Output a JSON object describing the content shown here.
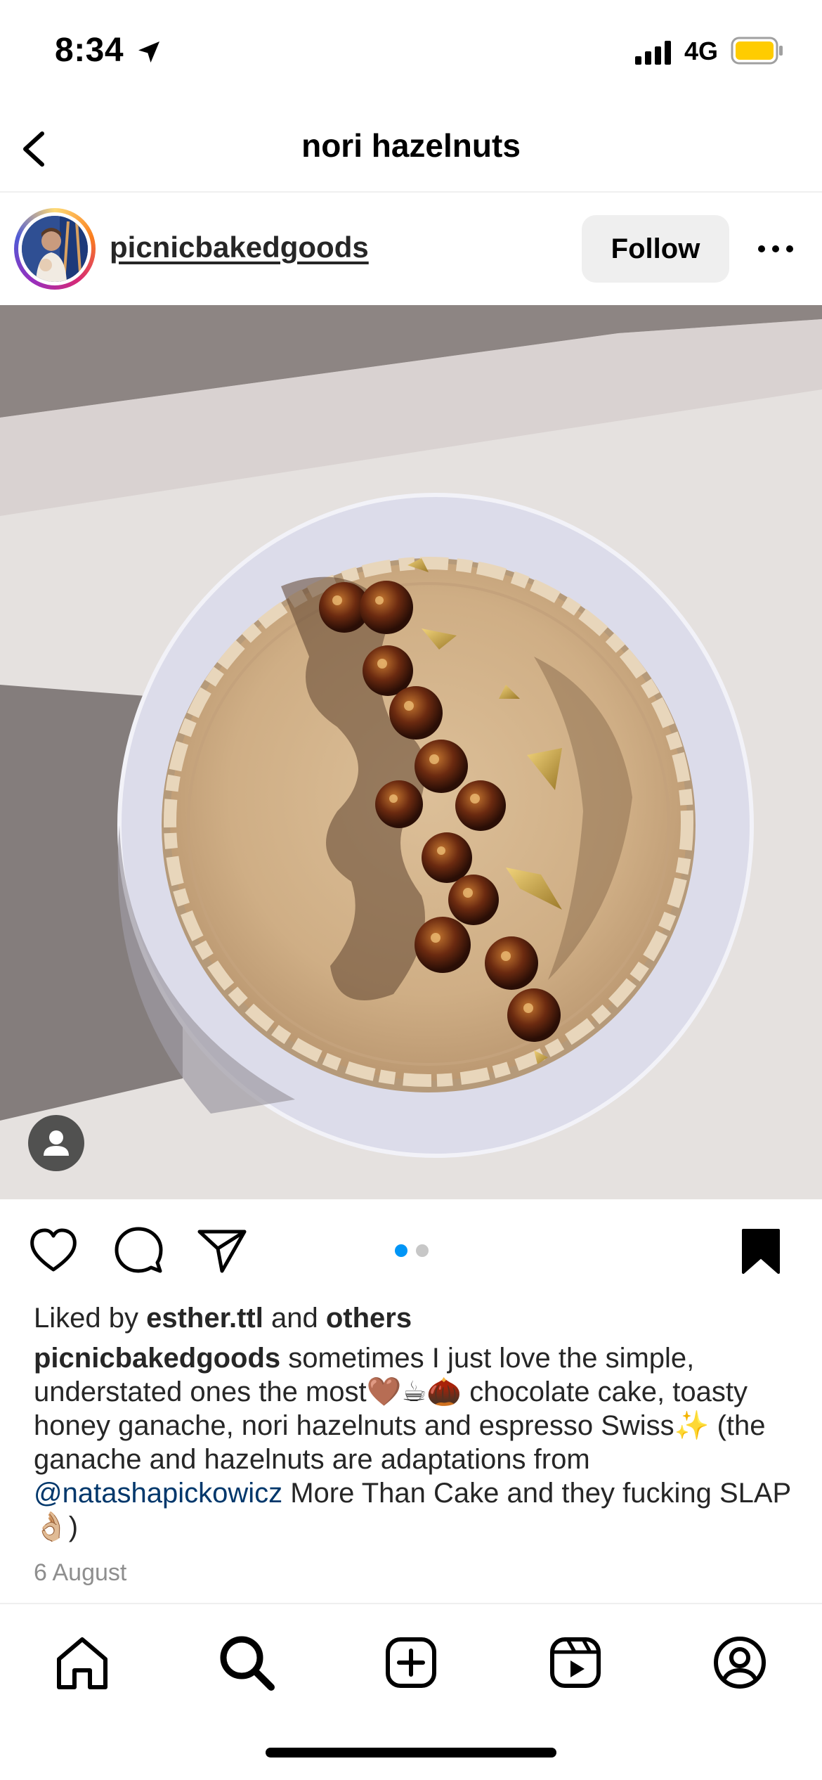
{
  "status_bar": {
    "time": "8:34",
    "network": "4G",
    "battery_color": "#FFCC00",
    "icons": [
      "location-arrow-icon",
      "signal-bars-icon",
      "battery-icon"
    ]
  },
  "header": {
    "title": "nori hazelnuts",
    "back_icon": "chevron-left-icon"
  },
  "post": {
    "username": "picnicbakedgoods",
    "follow_label": "Follow",
    "more_icon": "ellipsis-icon",
    "carousel": {
      "current": 1,
      "total": 2
    },
    "tag_icon": "person-tag-icon",
    "image_description_icon": "cake-photo"
  },
  "actions": {
    "icons": [
      "heart-icon",
      "comment-icon",
      "paper-plane-icon",
      "bookmark-filled-icon"
    ]
  },
  "likes": {
    "prefix": "Liked by",
    "user": "esther.ttl",
    "middle": "and",
    "others": "others"
  },
  "caption": {
    "user": "picnicbakedgoods",
    "text_part1": " sometimes I just love the simple, understated ones the most🤎☕🌰 chocolate cake, toasty honey ganache, nori hazelnuts and espresso Swiss✨ (the ganache and hazelnuts are adaptations from ",
    "mention": "@natashapickowicz",
    "text_part2": " More Than Cake and they fucking SLAP👌🏼)"
  },
  "date": "6 August",
  "tab_bar": {
    "tabs": [
      "home-icon",
      "search-icon",
      "create-post-icon",
      "reels-icon",
      "profile-icon"
    ]
  },
  "colors": {
    "accent": "#0095f6",
    "mention": "#00376b",
    "muted": "#8e8e8e",
    "button_bg": "#efefef"
  }
}
